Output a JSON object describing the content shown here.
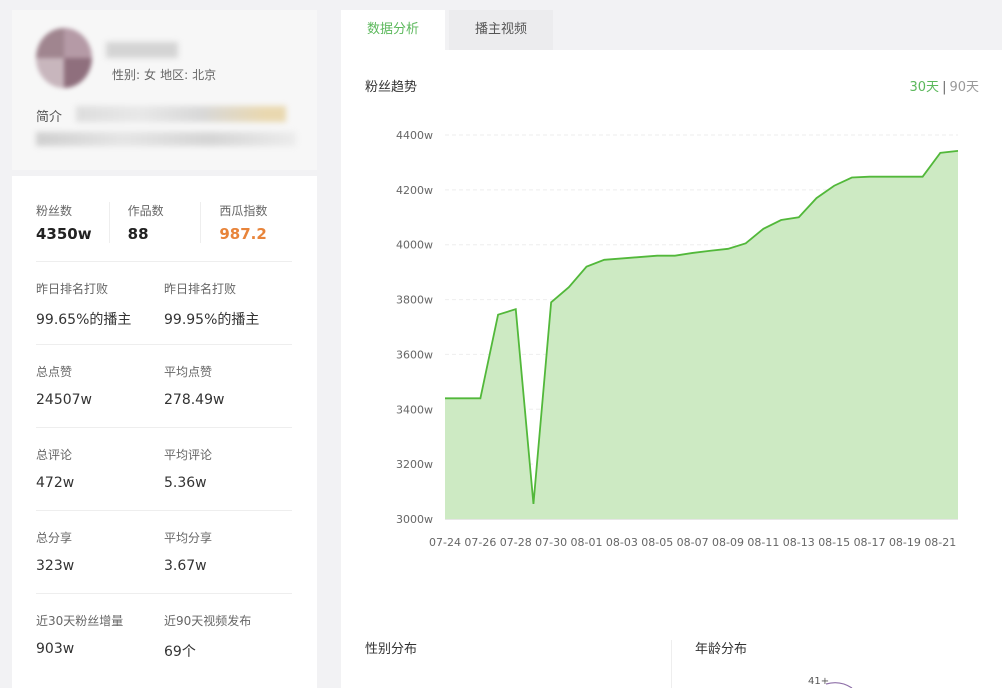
{
  "profile": {
    "gender_label": "性别:",
    "gender": "女",
    "region_label": "地区:",
    "region": "北京",
    "intro_label": "简介"
  },
  "stats": {
    "fans": {
      "label": "粉丝数",
      "value": "4350w"
    },
    "works": {
      "label": "作品数",
      "value": "88"
    },
    "xigua": {
      "label": "西瓜指数",
      "value": "987.2"
    },
    "rows": [
      [
        {
          "label": "昨日排名打败",
          "value": "99.65%的播主"
        },
        {
          "label": "昨日排名打败",
          "value": "99.95%的播主"
        }
      ],
      [
        {
          "label": "总点赞",
          "value": "24507w"
        },
        {
          "label": "平均点赞",
          "value": "278.49w"
        }
      ],
      [
        {
          "label": "总评论",
          "value": "472w"
        },
        {
          "label": "平均评论",
          "value": "5.36w"
        }
      ],
      [
        {
          "label": "总分享",
          "value": "323w"
        },
        {
          "label": "平均分享",
          "value": "3.67w"
        }
      ],
      [
        {
          "label": "近30天粉丝增量",
          "value": "903w"
        },
        {
          "label": "近90天视频发布",
          "value": "69个"
        }
      ]
    ]
  },
  "tabs": [
    {
      "label": "数据分析",
      "active": true
    },
    {
      "label": "播主视频",
      "active": false
    }
  ],
  "trend": {
    "title": "粉丝趋势",
    "range_30": "30天",
    "range_sep": "|",
    "range_90": "90天"
  },
  "bottom": {
    "gender_title": "性别分布",
    "age_title": "年龄分布",
    "age_partial_label": "41+"
  },
  "colors": {
    "accent": "#5cb85c",
    "line": "#52b83a",
    "area": "#cdeac3",
    "orange": "#e8843a"
  },
  "chart_data": {
    "type": "area",
    "title": "粉丝趋势",
    "unit": "w",
    "ylim": [
      3000,
      4400
    ],
    "yticks": [
      "3000w",
      "3200w",
      "3400w",
      "3600w",
      "3800w",
      "4000w",
      "4200w",
      "4400w"
    ],
    "x_tick_labels": [
      "07-24",
      "07-26",
      "07-28",
      "07-30",
      "08-01",
      "08-03",
      "08-05",
      "08-07",
      "08-09",
      "08-11",
      "08-13",
      "08-15",
      "08-17",
      "08-19",
      "08-21"
    ],
    "x": [
      "07-24",
      "07-25",
      "07-26",
      "07-27",
      "07-28",
      "07-29",
      "07-30",
      "07-31",
      "08-01",
      "08-02",
      "08-03",
      "08-04",
      "08-05",
      "08-06",
      "08-07",
      "08-08",
      "08-09",
      "08-10",
      "08-11",
      "08-12",
      "08-13",
      "08-14",
      "08-15",
      "08-16",
      "08-17",
      "08-18",
      "08-19",
      "08-20",
      "08-21",
      "08-22"
    ],
    "values": [
      3440,
      3440,
      3440,
      3745,
      3765,
      3055,
      3790,
      3845,
      3920,
      3945,
      3950,
      3955,
      3960,
      3960,
      3970,
      3978,
      3985,
      4005,
      4058,
      4090,
      4100,
      4170,
      4215,
      4245,
      4248,
      4248,
      4248,
      4248,
      4335,
      4342
    ],
    "grid": true,
    "legend": "none"
  }
}
